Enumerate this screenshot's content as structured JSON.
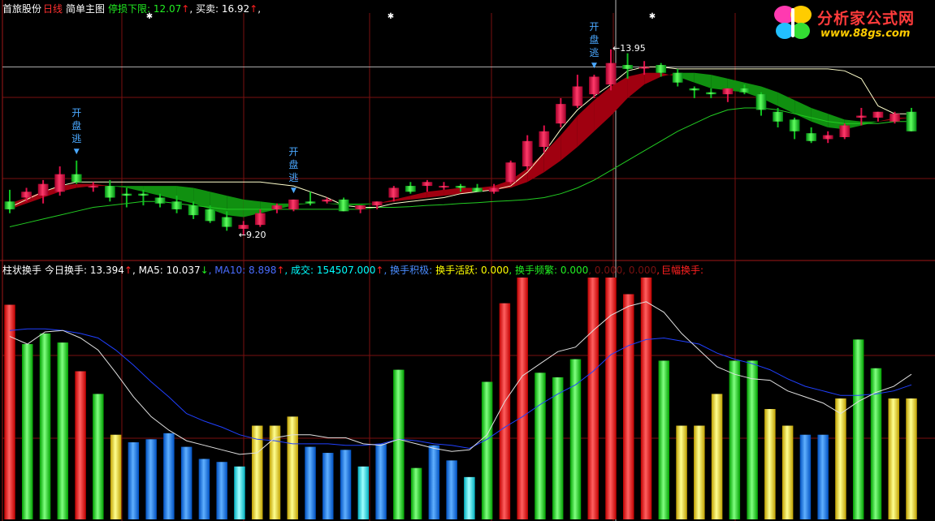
{
  "colors": {
    "background": "#000000",
    "up": "#e0104a",
    "down": "#10c020",
    "grid": "#7a1010",
    "ma_white": "#ffffff",
    "ma_blue": "#2040ff",
    "label_white": "#ffffff",
    "label_yellow": "#ffff00",
    "label_green": "#22ee22",
    "label_cyan": "#00ffff",
    "label_blue": "#4a6cff",
    "label_red": "#ff2020",
    "label_magenta": "#ff40ff",
    "label_dimred": "#7a1010"
  },
  "header_main": {
    "stock": "首旅股份",
    "period": "日线",
    "indicator": "简单主图",
    "stop_label": "停损下限: 12.07",
    "stop_arrow": "↑",
    "trade_label": ", 买卖: 16.92",
    "trade_arrow": "↑",
    "trail": ","
  },
  "header_sub": {
    "name": "柱状换手",
    "today": "今日换手: 13.394",
    "today_arrow": "↑",
    "ma5": ", MA5: 10.037",
    "ma5_arrow": "↓",
    "ma10": ", MA10: 8.898",
    "ma10_arrow": "↑",
    "vol": ", 成交: 154507.000",
    "vol_arrow": "↑",
    "active": ", 换手积极:",
    "lively": "换手活跃: 0.000",
    "freq": ", 换手频繁: 0.000",
    "dim": ", 0.000, 0.000",
    "sep": ",",
    "huge": "巨幅换手:"
  },
  "logo": {
    "name": "分析家公式网",
    "url": "www.88gs.com"
  },
  "annotations": [
    {
      "text": "开盘逃",
      "index": 4
    },
    {
      "text": "开盘逃",
      "index": 17
    },
    {
      "text": "开盘逃",
      "index": 35
    }
  ],
  "price_labels": {
    "low": "9.20",
    "high": "13.95"
  },
  "chart_data": [
    {
      "type": "candlestick",
      "ylim": [
        8.6,
        14.8
      ],
      "ohlc": [
        [
          10.05,
          10.35,
          9.75,
          9.85
        ],
        [
          10.15,
          10.4,
          10.05,
          10.3
        ],
        [
          10.2,
          10.6,
          10.0,
          10.5
        ],
        [
          10.3,
          10.95,
          10.2,
          10.75
        ],
        [
          10.75,
          11.1,
          10.5,
          10.55
        ],
        [
          10.45,
          10.55,
          10.3,
          10.45
        ],
        [
          10.45,
          10.6,
          10.05,
          10.15
        ],
        [
          10.25,
          10.4,
          9.9,
          10.2
        ],
        [
          10.25,
          10.35,
          9.95,
          10.2
        ],
        [
          10.15,
          10.25,
          9.9,
          10.0
        ],
        [
          10.05,
          10.2,
          9.75,
          9.85
        ],
        [
          9.95,
          10.05,
          9.6,
          9.7
        ],
        [
          9.85,
          9.95,
          9.5,
          9.55
        ],
        [
          9.65,
          9.8,
          9.3,
          9.4
        ],
        [
          9.35,
          9.55,
          9.2,
          9.45
        ],
        [
          9.45,
          9.85,
          9.4,
          9.75
        ],
        [
          9.85,
          10.0,
          9.75,
          9.95
        ],
        [
          9.85,
          10.1,
          9.8,
          10.1
        ],
        [
          10.05,
          10.3,
          9.95,
          10.0
        ],
        [
          10.05,
          10.15,
          10.0,
          10.1
        ],
        [
          10.1,
          10.15,
          9.8,
          9.8
        ],
        [
          9.85,
          9.95,
          9.75,
          9.95
        ],
        [
          9.95,
          10.05,
          9.85,
          10.05
        ],
        [
          10.15,
          10.45,
          10.05,
          10.4
        ],
        [
          10.45,
          10.55,
          10.25,
          10.3
        ],
        [
          10.45,
          10.6,
          10.3,
          10.55
        ],
        [
          10.45,
          10.55,
          10.35,
          10.45
        ],
        [
          10.45,
          10.5,
          10.3,
          10.4
        ],
        [
          10.4,
          10.5,
          10.3,
          10.3
        ],
        [
          10.3,
          10.5,
          10.25,
          10.4
        ],
        [
          10.55,
          11.1,
          10.5,
          11.05
        ],
        [
          10.95,
          11.75,
          10.85,
          11.6
        ],
        [
          11.45,
          12.0,
          11.3,
          11.85
        ],
        [
          12.05,
          12.7,
          11.95,
          12.55
        ],
        [
          12.5,
          13.3,
          12.45,
          13.0
        ],
        [
          12.8,
          13.3,
          12.7,
          13.25
        ],
        [
          13.05,
          13.95,
          12.9,
          13.6
        ],
        [
          13.55,
          13.85,
          13.2,
          13.45
        ],
        [
          13.5,
          13.65,
          13.3,
          13.5
        ],
        [
          13.55,
          13.6,
          13.25,
          13.35
        ],
        [
          13.35,
          13.45,
          13.0,
          13.1
        ],
        [
          12.95,
          13.0,
          12.7,
          12.9
        ],
        [
          12.85,
          12.95,
          12.7,
          12.8
        ],
        [
          12.8,
          12.95,
          12.6,
          12.95
        ],
        [
          12.95,
          13.05,
          12.8,
          12.85
        ],
        [
          12.8,
          12.85,
          12.25,
          12.4
        ],
        [
          12.35,
          12.45,
          11.95,
          12.1
        ],
        [
          12.15,
          12.2,
          11.65,
          11.85
        ],
        [
          11.8,
          11.95,
          11.55,
          11.6
        ],
        [
          11.65,
          11.85,
          11.55,
          11.75
        ],
        [
          11.7,
          12.05,
          11.65,
          12.0
        ],
        [
          12.2,
          12.45,
          12.0,
          12.25
        ],
        [
          12.2,
          12.35,
          12.1,
          12.35
        ],
        [
          12.1,
          12.35,
          12.05,
          12.3
        ],
        [
          12.35,
          12.45,
          11.85,
          11.85
        ]
      ],
      "ma_white": [
        9.9,
        10.1,
        10.3,
        10.45,
        10.55,
        10.55,
        10.55,
        10.55,
        10.55,
        10.55,
        10.55,
        10.55,
        10.55,
        10.55,
        10.55,
        10.55,
        10.5,
        10.45,
        10.3,
        10.15,
        9.95,
        9.9,
        9.9,
        10.0,
        10.05,
        10.1,
        10.15,
        10.25,
        10.3,
        10.35,
        10.45,
        10.8,
        11.3,
        11.9,
        12.4,
        12.75,
        13.05,
        13.4,
        13.5,
        13.5,
        13.45,
        13.45,
        13.45,
        13.45,
        13.45,
        13.45,
        13.45,
        13.45,
        13.45,
        13.45,
        13.4,
        13.2,
        12.5,
        12.3,
        12.3
      ],
      "ma_green": [
        9.4,
        9.5,
        9.6,
        9.7,
        9.8,
        9.9,
        9.95,
        10.0,
        10.05,
        10.05,
        10.0,
        9.95,
        9.9,
        9.85,
        9.85,
        9.85,
        9.85,
        9.85,
        9.85,
        9.85,
        9.85,
        9.85,
        9.9,
        9.9,
        9.92,
        9.95,
        9.97,
        10.0,
        10.02,
        10.05,
        10.07,
        10.1,
        10.15,
        10.25,
        10.4,
        10.6,
        10.85,
        11.1,
        11.35,
        11.6,
        11.85,
        12.05,
        12.25,
        12.4,
        12.45,
        12.45,
        12.4,
        12.3,
        12.2,
        12.1,
        12.05,
        12.05,
        12.05,
        12.1,
        12.1
      ],
      "band_a": [
        10.0,
        10.15,
        10.3,
        10.45,
        10.5,
        10.5,
        10.45,
        10.4,
        10.3,
        10.2,
        10.1,
        10.0,
        9.85,
        9.7,
        9.65,
        9.75,
        9.85,
        9.95,
        10.0,
        10.0,
        9.95,
        9.95,
        10.0,
        10.1,
        10.2,
        10.3,
        10.35,
        10.4,
        10.4,
        10.45,
        10.6,
        10.9,
        11.3,
        11.75,
        12.25,
        12.65,
        13.0,
        13.25,
        13.35,
        13.35,
        13.25,
        13.1,
        12.95,
        12.9,
        12.85,
        12.7,
        12.5,
        12.3,
        12.1,
        11.95,
        11.9,
        12.0,
        12.1,
        12.2,
        12.2
      ],
      "band_b": [
        9.85,
        10.0,
        10.15,
        10.3,
        10.4,
        10.45,
        10.45,
        10.45,
        10.45,
        10.45,
        10.45,
        10.4,
        10.3,
        10.2,
        10.1,
        10.05,
        10.0,
        10.0,
        10.0,
        10.0,
        10.0,
        10.0,
        10.0,
        10.05,
        10.1,
        10.15,
        10.2,
        10.25,
        10.3,
        10.35,
        10.4,
        10.55,
        10.8,
        11.1,
        11.45,
        11.85,
        12.25,
        12.7,
        13.05,
        13.25,
        13.35,
        13.35,
        13.3,
        13.2,
        13.1,
        13.0,
        12.85,
        12.65,
        12.45,
        12.3,
        12.15,
        12.1,
        12.1,
        12.15,
        12.2
      ],
      "hline": 13.5
    },
    {
      "type": "bar",
      "ylim": [
        0,
        16
      ],
      "values": [
        14.2,
        11.6,
        12.3,
        11.7,
        9.8,
        8.3,
        5.6,
        5.1,
        5.3,
        5.7,
        4.8,
        4.0,
        3.8,
        3.5,
        6.2,
        6.2,
        6.8,
        4.8,
        4.4,
        4.6,
        3.5,
        5.0,
        9.9,
        3.4,
        4.9,
        3.9,
        2.8,
        9.1,
        14.3,
        16.0,
        9.7,
        9.4,
        10.6,
        16.0,
        16.0,
        14.9,
        16.0,
        10.5,
        6.2,
        6.2,
        8.3,
        10.5,
        10.5,
        7.3,
        6.2,
        5.6,
        5.6,
        8.0,
        11.9,
        10.0,
        8.0,
        8.0
      ],
      "bar_colors": [
        "red",
        "green",
        "green",
        "green",
        "red",
        "green",
        "yellow",
        "blue",
        "blue",
        "blue",
        "blue",
        "blue",
        "blue",
        "cyan",
        "yellow",
        "yellow",
        "yellow",
        "blue",
        "blue",
        "blue",
        "cyan",
        "blue",
        "green",
        "green",
        "blue",
        "blue",
        "cyan",
        "green",
        "red",
        "red",
        "green",
        "green",
        "green",
        "red",
        "red",
        "red",
        "red",
        "green",
        "yellow",
        "yellow",
        "yellow",
        "green",
        "green",
        "yellow",
        "yellow",
        "blue",
        "blue",
        "yellow",
        "green",
        "green",
        "yellow",
        "yellow"
      ],
      "ma5": [
        12.1,
        11.6,
        12.4,
        12.5,
        12.0,
        11.2,
        9.7,
        8.1,
        6.8,
        5.9,
        5.2,
        4.9,
        4.6,
        4.3,
        4.4,
        5.4,
        5.6,
        5.6,
        5.4,
        5.4,
        5.0,
        4.9,
        5.3,
        5.0,
        4.7,
        4.5,
        4.6,
        5.6,
        7.8,
        9.5,
        10.3,
        11.1,
        11.4,
        12.5,
        13.5,
        14.1,
        14.4,
        13.7,
        12.3,
        11.2,
        10.1,
        9.6,
        9.3,
        9.2,
        8.5,
        8.1,
        7.7,
        7.0,
        7.8,
        8.4,
        8.8,
        9.6
      ],
      "ma10": [
        12.5,
        12.6,
        12.6,
        12.5,
        12.3,
        12.0,
        11.2,
        10.2,
        9.1,
        8.1,
        7.0,
        6.5,
        6.1,
        5.6,
        5.3,
        5.2,
        5.0,
        5.0,
        5.0,
        4.9,
        4.9,
        5.0,
        5.3,
        5.2,
        5.0,
        4.9,
        4.7,
        5.3,
        6.1,
        6.8,
        7.6,
        8.3,
        8.9,
        9.8,
        10.9,
        11.5,
        11.9,
        12.0,
        11.8,
        11.6,
        11.0,
        10.6,
        10.3,
        9.9,
        9.3,
        8.8,
        8.5,
        8.2,
        8.2,
        8.3,
        8.5,
        8.9
      ]
    }
  ]
}
